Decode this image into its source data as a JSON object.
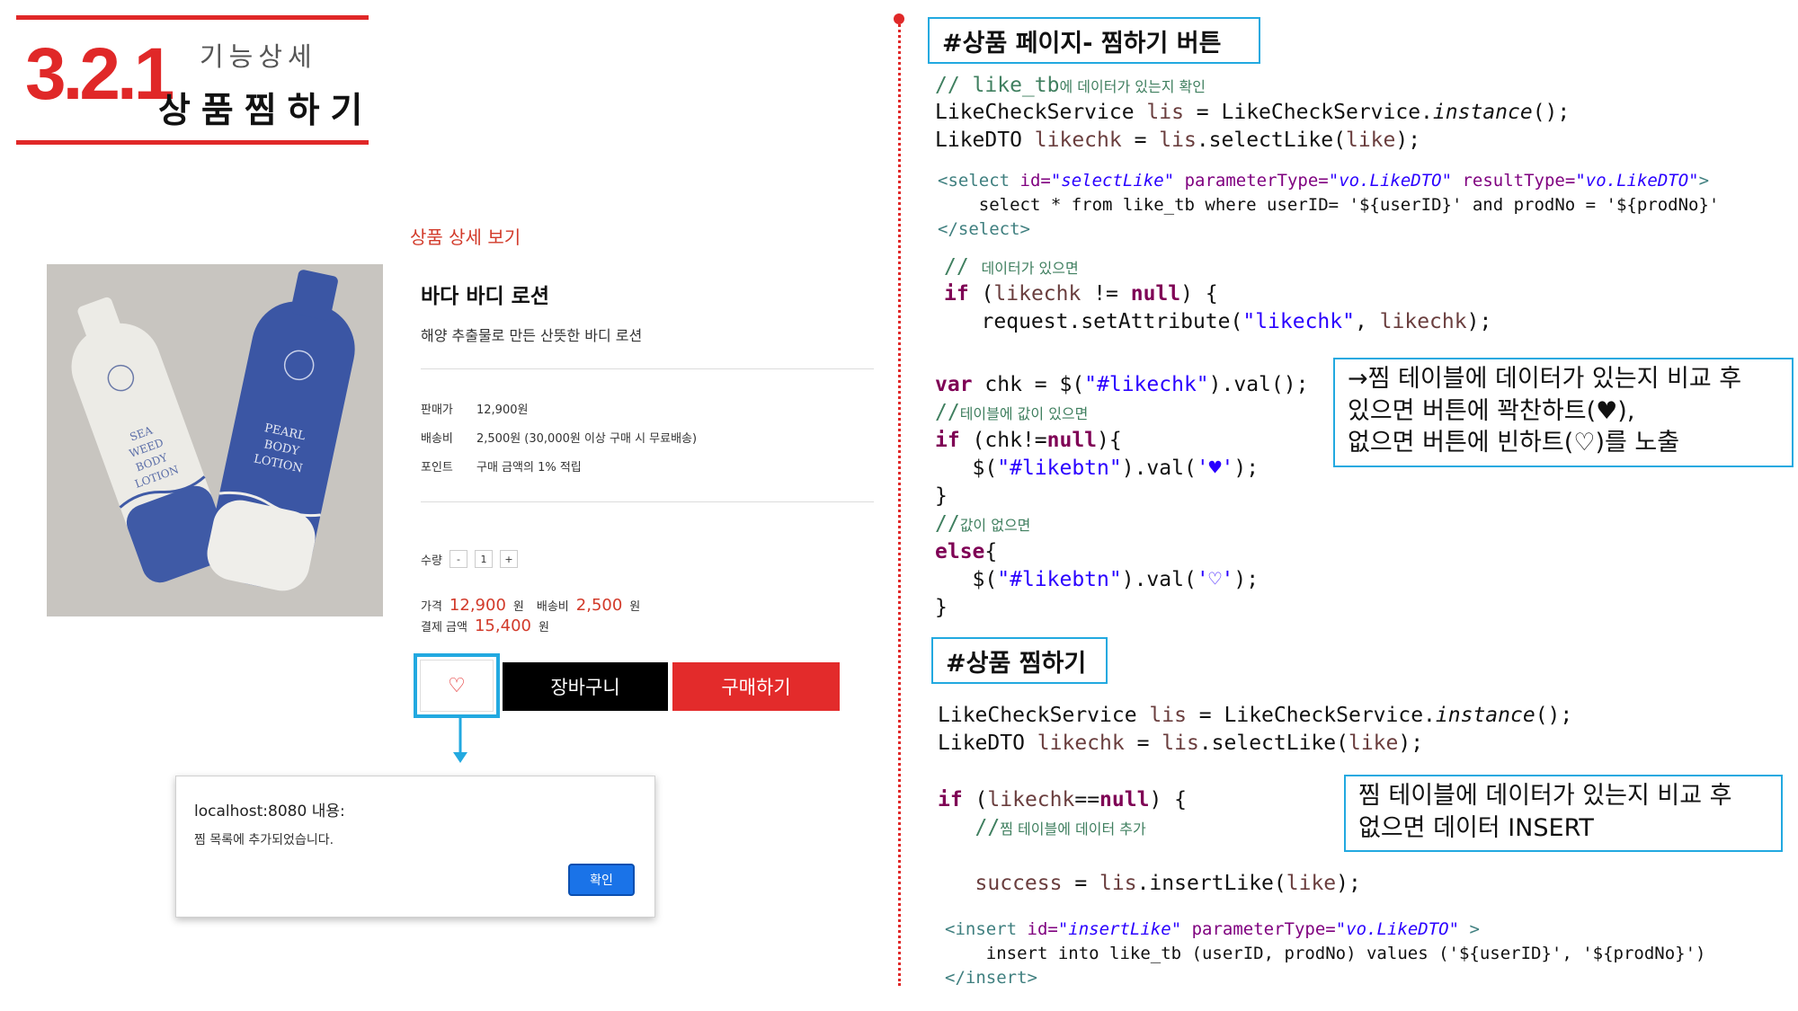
{
  "header": {
    "section_number": "3.2.1",
    "subtitle": "기능상세",
    "title": "상품찜하기"
  },
  "product": {
    "detail_link": "상품 상세 보기",
    "name": "바다 바디 로션",
    "description": "해양 추출물로 만든 산뜻한 바디 로션",
    "info": [
      {
        "label": "판매가",
        "value": "12,900원"
      },
      {
        "label": "배송비",
        "value": "2,500원 (30,000원 이상 구매 시 무료배송)"
      },
      {
        "label": "포인트",
        "value": "구매 금액의 1% 적립"
      }
    ],
    "quantity_label": "수량",
    "quantity_minus": "-",
    "quantity_value": "1",
    "quantity_plus": "+",
    "price_label": "가격",
    "price_value": "12,900",
    "won": "원",
    "shipping_label": "배송비",
    "shipping_value": "2,500",
    "total_label": "결제 금액",
    "total_value": "15,400",
    "like_symbol": "♡",
    "cart_button": "장바구니",
    "buy_button": "구매하기"
  },
  "bottle_text": {
    "front": [
      "PEARL",
      "BODY",
      "LOTION"
    ],
    "back": [
      "SEA",
      "WEED",
      "BODY",
      "LOTION"
    ]
  },
  "dialog": {
    "title": "localhost:8080 내용:",
    "message": "찜 목록에 추가되었습니다.",
    "ok_button": "확인"
  },
  "panel": {
    "heading1": "#상품 페이지- 찜하기 버튼",
    "heading2": "#상품 찜하기",
    "note1": [
      "→찜 테이블에 데이터가 있는지 비교 후",
      "있으면 버튼에 꽉찬하트(♥),",
      "없으면 버튼에 빈하트(♡)를 노출"
    ],
    "note2": [
      "찜 테이블에 데이터가 있는지 비교 후",
      "없으면 데이터 INSERT"
    ]
  },
  "colors": {
    "accent_red": "#e02828",
    "highlight_blue": "#22a9e0",
    "dialog_button": "#1a73e8"
  }
}
